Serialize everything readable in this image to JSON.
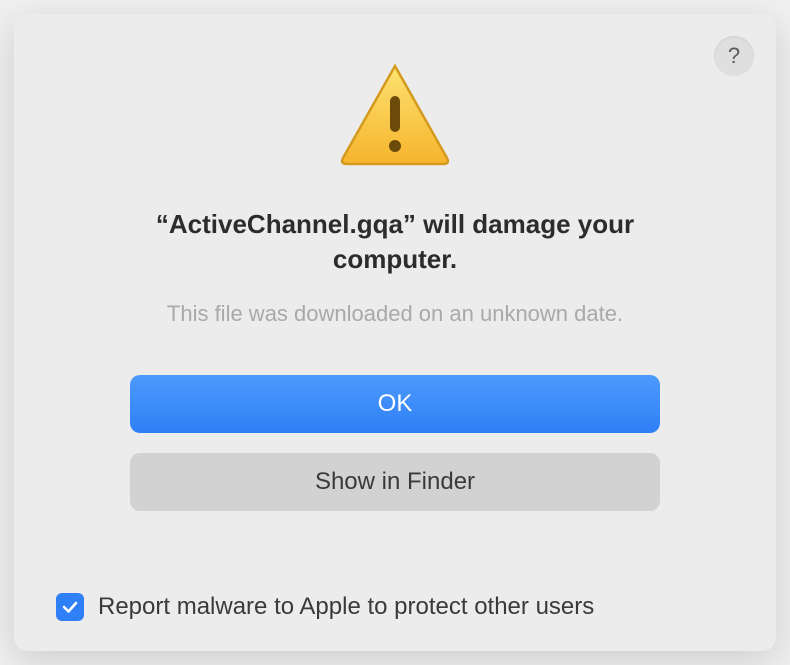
{
  "help": {
    "label": "?"
  },
  "dialog": {
    "heading": "“ActiveChannel.gqa” will damage your computer.",
    "subtext": "This file was downloaded on an unknown date.",
    "primary_button": "OK",
    "secondary_button": "Show in Finder",
    "checkbox_label": "Report malware to Apple to protect other users",
    "checkbox_checked": true
  },
  "colors": {
    "accent": "#2f7ff6",
    "warning_fill": "#facc15",
    "warning_stroke": "#c99c0c"
  }
}
